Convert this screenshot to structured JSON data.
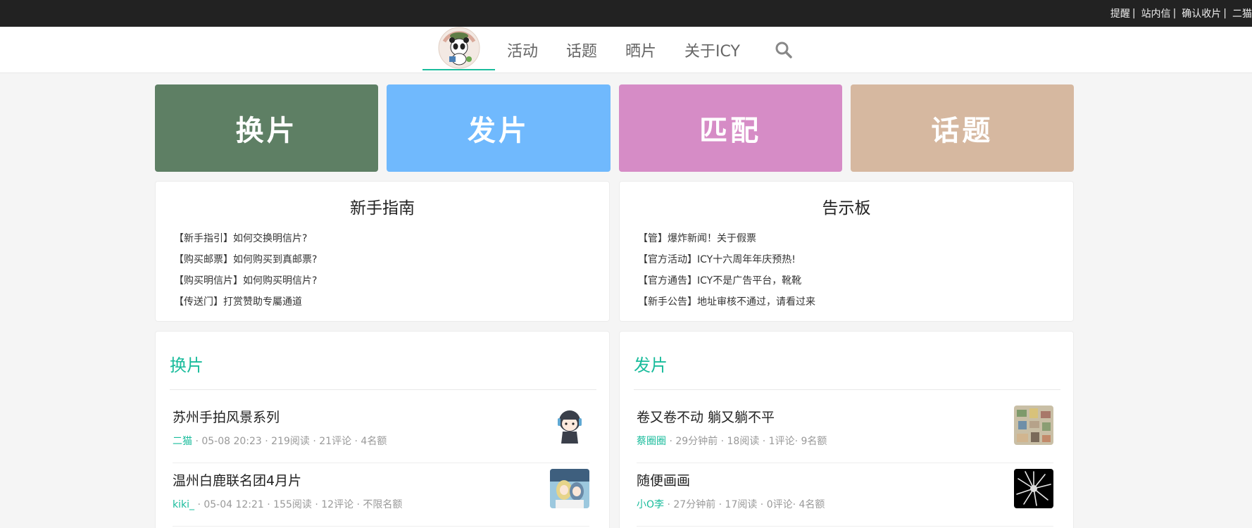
{
  "topbar": {
    "links": [
      "提醒",
      "站内信",
      "确认收片",
      "二猫"
    ],
    "separator": "|"
  },
  "nav": {
    "items": [
      "活动",
      "话题",
      "晒片",
      "关于ICY"
    ]
  },
  "tiles": [
    {
      "label": "换片",
      "color": "#5e7f64"
    },
    {
      "label": "发片",
      "color": "#70b9fd"
    },
    {
      "label": "匹配",
      "color": "#d68cc6"
    },
    {
      "label": "话题",
      "color": "#d6b8a0"
    }
  ],
  "guide": {
    "title": "新手指南",
    "items": [
      "【新手指引】如何交换明信片?",
      "【购买邮票】如何购买到真邮票?",
      "【购买明信片】如何购买明信片?",
      "【传送门】打赏赞助专屬通道"
    ]
  },
  "board": {
    "title": "告示板",
    "items": [
      "【管】爆炸新闻！关于假票",
      "【官方活动】ICY十六周年年庆预热!",
      "【官方通告】ICY不是广告平台，靴靴",
      "【新手公告】地址审核不通过，请看过来"
    ]
  },
  "exchange": {
    "title": "换片",
    "items": [
      {
        "title": "苏州手拍风景系列",
        "author": "二猫",
        "meta": " · 05-08 20:23 · 219阅读 · 21评论 · 4名额"
      },
      {
        "title": "温州白鹿联名团4月片",
        "author": "kiki_",
        "meta": " · 05-04 12:21 · 155阅读 · 12评论 · 不限名额"
      }
    ]
  },
  "send": {
    "title": "发片",
    "items": [
      {
        "title": "卷又卷不动 躺又躺不平",
        "author": "蔡圈圈",
        "meta": " · 29分钟前 · 18阅读 · 1评论· 9名额"
      },
      {
        "title": "随便画画",
        "author": "小O李",
        "meta": " · 27分钟前 · 17阅读 · 0评论· 4名额"
      }
    ]
  },
  "colors": {
    "accent": "#1abc9c",
    "topbar": "#222222"
  }
}
